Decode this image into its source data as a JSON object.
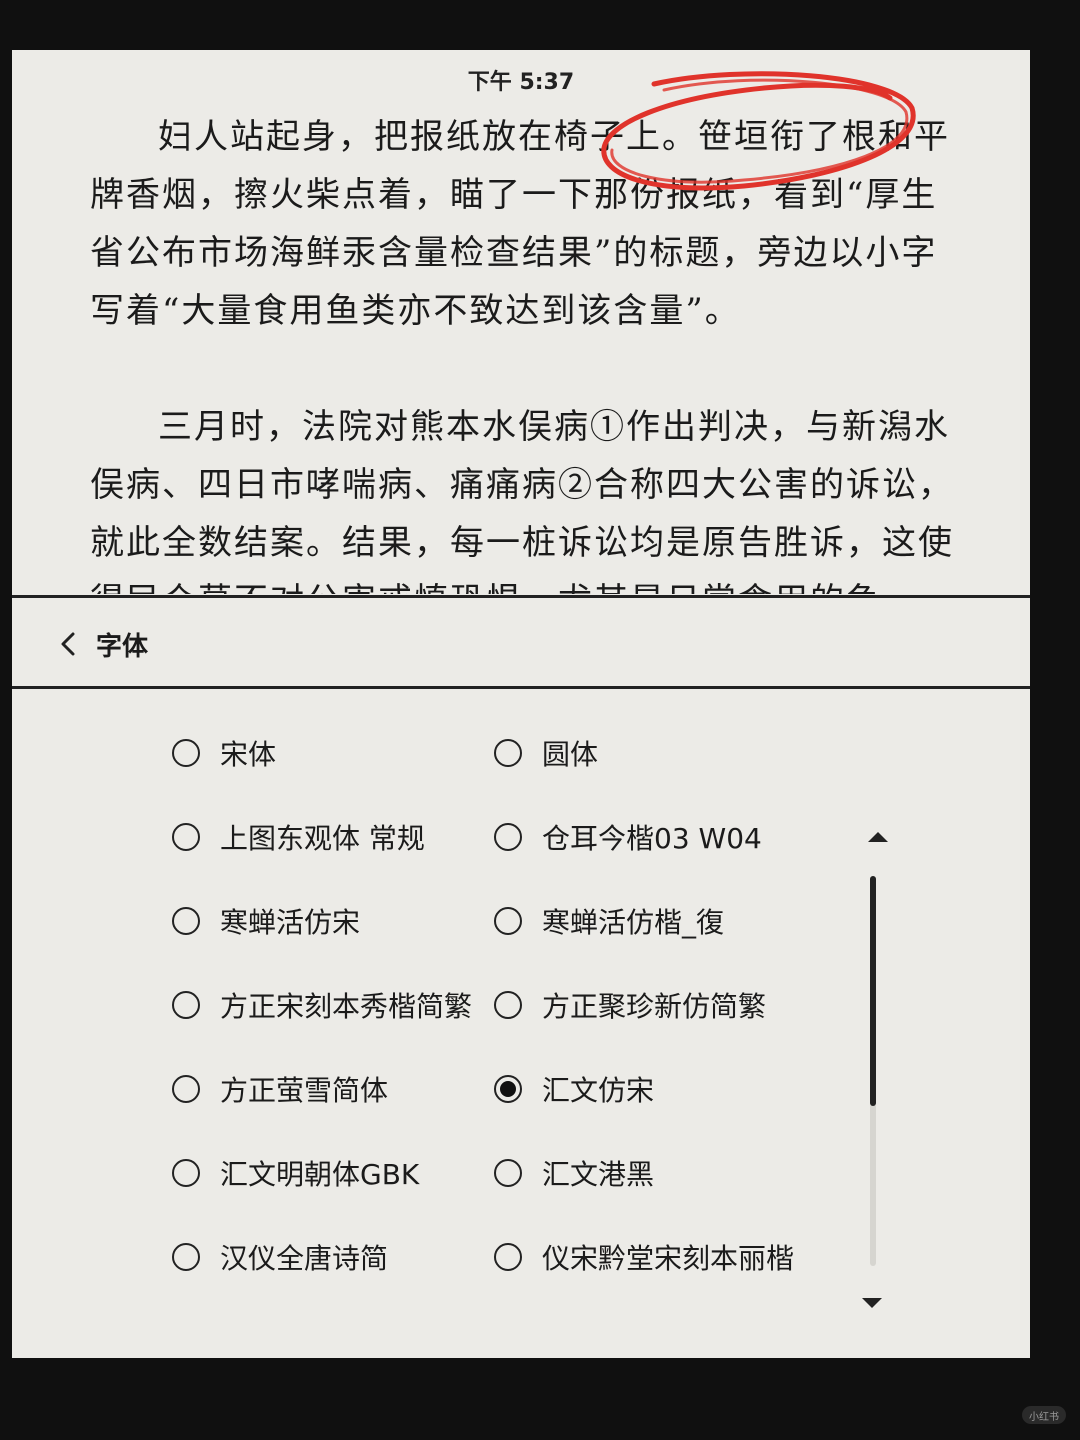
{
  "status_bar": {
    "time": "下午 5:37"
  },
  "reading": {
    "paragraphs": [
      "妇人站起身，把报纸放在椅子上。笹垣衔了根和平牌香烟，擦火柴点着，瞄了一下那份报纸，看到“厚生省公布市场海鲜汞含量检查结果”的标题，旁边以小字写着“大量食用鱼类亦不致达到该含量”。",
      "三月时，法院对熊本水俣病①作出判决，与新潟水俣病、四日市哮喘病、痛痛病②合称四大公害的诉讼，就此全数结案。结果，每一桩诉讼均是原告胜诉，这使得民众莫不对公害戒慎恐惧。尤其是日常食用的鱼"
    ],
    "annotation_color": "#e0332b"
  },
  "font_panel": {
    "title": "字体",
    "back_icon": "chevron-left-icon",
    "scroll_up_icon": "triangle-up-icon",
    "scroll_down_icon": "triangle-down-icon",
    "scroll_position": 0.55,
    "options": [
      {
        "label": "宋体",
        "selected": false
      },
      {
        "label": "圆体",
        "selected": false
      },
      {
        "label": "上图东观体 常规",
        "selected": false
      },
      {
        "label": "仓耳今楷03 W04",
        "selected": false
      },
      {
        "label": "寒蝉活仿宋",
        "selected": false
      },
      {
        "label": "寒蝉活仿楷_復",
        "selected": false
      },
      {
        "label": "方正宋刻本秀楷简繁",
        "selected": false
      },
      {
        "label": "方正聚珍新仿简繁",
        "selected": false
      },
      {
        "label": "方正萤雪简体",
        "selected": false
      },
      {
        "label": "汇文仿宋",
        "selected": true
      },
      {
        "label": "汇文明朝体GBK",
        "selected": false
      },
      {
        "label": "汇文港黑",
        "selected": false
      },
      {
        "label": "汉仪全唐诗简",
        "selected": false
      },
      {
        "label": "仪宋黔堂宋刻本丽楷",
        "selected": false
      }
    ]
  },
  "watermark": "小红书"
}
